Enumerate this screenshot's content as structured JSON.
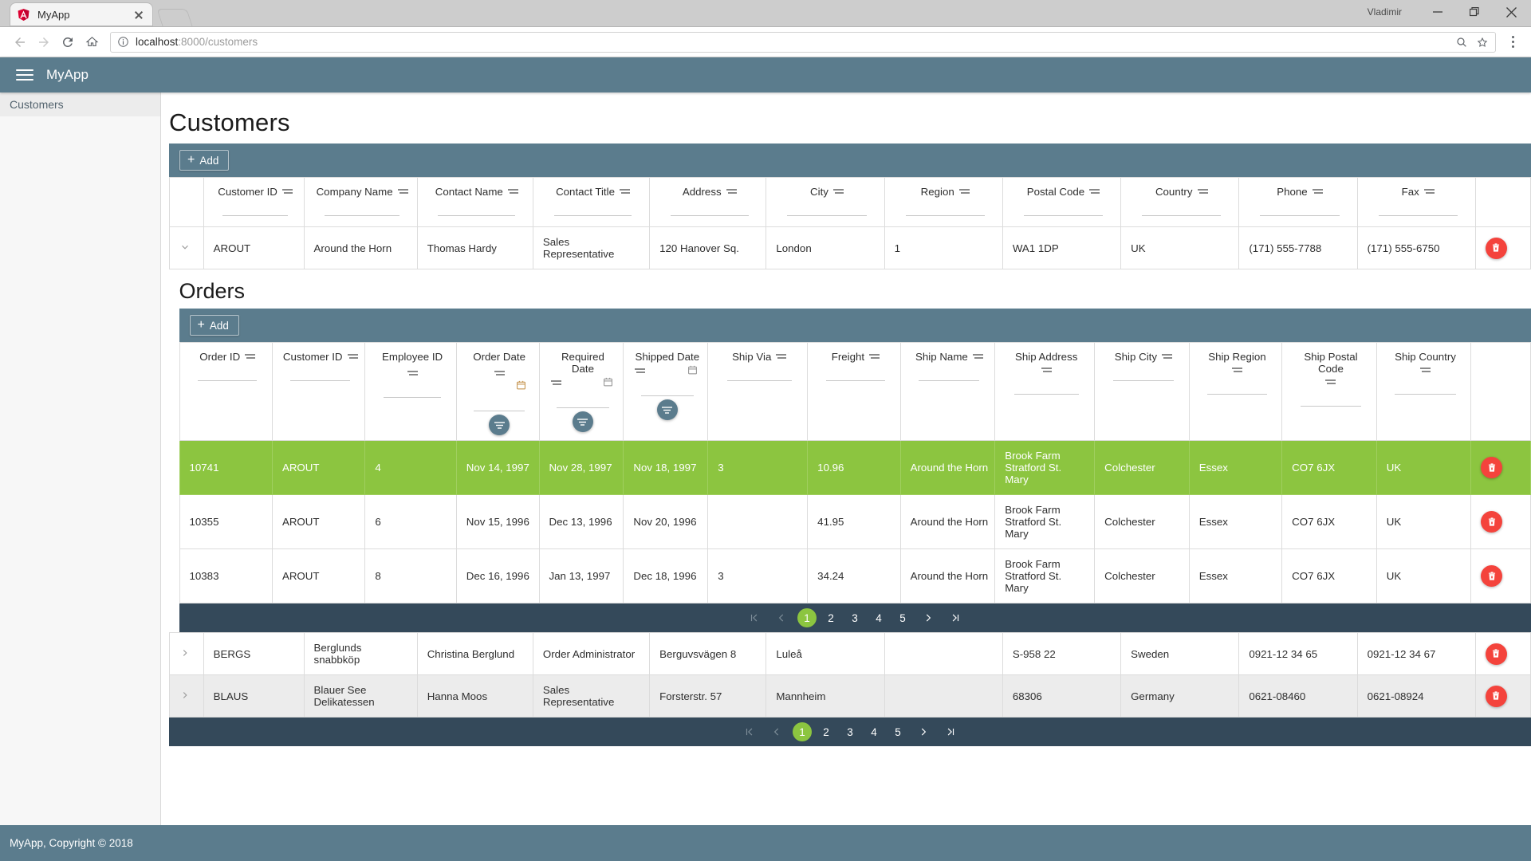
{
  "browser": {
    "tab_title": "MyApp",
    "favicon": "angular-logo-icon",
    "profile_name": "Vladimir",
    "url_host": "localhost",
    "url_rest": ":8000/customers",
    "back_icon": "back-arrow-icon",
    "forward_icon": "forward-arrow-icon",
    "reload_icon": "reload-icon",
    "home_icon": "home-icon",
    "info_icon": "page-info-icon",
    "search_icon": "search-icon",
    "star_icon": "bookmark-star-icon",
    "menu_icon": "browser-menu-icon",
    "minimize_icon": "minimize-icon",
    "maximize_icon": "restore-icon",
    "close_icon": "window-close-icon"
  },
  "app": {
    "title": "MyApp",
    "menu_icon": "hamburger-menu-icon",
    "footer": "MyApp, Copyright © 2018"
  },
  "sidebar": {
    "items": [
      {
        "label": "Customers"
      }
    ]
  },
  "customers": {
    "page_title": "Customers",
    "add_label": "Add",
    "columns": [
      "Customer ID",
      "Company Name",
      "Contact Name",
      "Contact Title",
      "Address",
      "City",
      "Region",
      "Postal Code",
      "Country",
      "Phone",
      "Fax"
    ],
    "filter_placeholder": "",
    "rows": [
      {
        "expanded": true,
        "customer_id": "AROUT",
        "company_name": "Around the Horn",
        "contact_name": "Thomas Hardy",
        "contact_title": "Sales Representative",
        "address": "120 Hanover Sq.",
        "city": "London",
        "region": "1",
        "postal_code": "WA1 1DP",
        "country": "UK",
        "phone": "(171) 555-7788",
        "fax": "(171) 555-6750"
      },
      {
        "expanded": false,
        "customer_id": "BERGS",
        "company_name": "Berglunds snabbköp",
        "contact_name": "Christina Berglund",
        "contact_title": "Order Administrator",
        "address": "Berguvsvägen 8",
        "city": "Luleå",
        "region": "",
        "postal_code": "S-958 22",
        "country": "Sweden",
        "phone": "0921-12 34 65",
        "fax": "0921-12 34 67"
      },
      {
        "expanded": false,
        "customer_id": "BLAUS",
        "company_name": "Blauer See Delikatessen",
        "contact_name": "Hanna Moos",
        "contact_title": "Sales Representative",
        "address": "Forsterstr. 57",
        "city": "Mannheim",
        "region": "",
        "postal_code": "68306",
        "country": "Germany",
        "phone": "0621-08460",
        "fax": "0621-08924"
      }
    ],
    "pager": {
      "first": "first-page-icon",
      "prev": "previous-page-icon",
      "pages": [
        "1",
        "2",
        "3",
        "4",
        "5"
      ],
      "active_page": "1",
      "next": "next-page-icon",
      "last": "last-page-icon"
    }
  },
  "orders": {
    "section_title": "Orders",
    "add_label": "Add",
    "columns": [
      {
        "label": "Order ID",
        "has_date": false
      },
      {
        "label": "Customer ID",
        "has_date": false
      },
      {
        "label": "Employee ID",
        "has_date": false
      },
      {
        "label": "Order Date",
        "has_date": true
      },
      {
        "label": "Required Date",
        "has_date": true
      },
      {
        "label": "Shipped Date",
        "has_date": true
      },
      {
        "label": "Ship Via",
        "has_date": false
      },
      {
        "label": "Freight",
        "has_date": false
      },
      {
        "label": "Ship Name",
        "has_date": false
      },
      {
        "label": "Ship Address",
        "has_date": false
      },
      {
        "label": "Ship City",
        "has_date": false
      },
      {
        "label": "Ship Region",
        "has_date": false
      },
      {
        "label": "Ship Postal Code",
        "has_date": false
      },
      {
        "label": "Ship Country",
        "has_date": false
      }
    ],
    "rows": [
      {
        "selected": true,
        "order_id": "10741",
        "customer_id": "AROUT",
        "employee_id": "4",
        "order_date": "Nov 14, 1997",
        "required_date": "Nov 28, 1997",
        "shipped_date": "Nov 18, 1997",
        "ship_via": "3",
        "freight": "10.96",
        "ship_name": "Around the Horn",
        "ship_address": "Brook Farm Stratford St. Mary",
        "ship_city": "Colchester",
        "ship_region": "Essex",
        "ship_postal_code": "CO7 6JX",
        "ship_country": "UK"
      },
      {
        "selected": false,
        "order_id": "10355",
        "customer_id": "AROUT",
        "employee_id": "6",
        "order_date": "Nov 15, 1996",
        "required_date": "Dec 13, 1996",
        "shipped_date": "Nov 20, 1996",
        "ship_via": "",
        "freight": "41.95",
        "ship_name": "Around the Horn",
        "ship_address": "Brook Farm Stratford St. Mary",
        "ship_city": "Colchester",
        "ship_region": "Essex",
        "ship_postal_code": "CO7 6JX",
        "ship_country": "UK"
      },
      {
        "selected": false,
        "order_id": "10383",
        "customer_id": "AROUT",
        "employee_id": "8",
        "order_date": "Dec 16, 1996",
        "required_date": "Jan 13, 1997",
        "shipped_date": "Dec 18, 1996",
        "ship_via": "3",
        "freight": "34.24",
        "ship_name": "Around the Horn",
        "ship_address": "Brook Farm Stratford St. Mary",
        "ship_city": "Colchester",
        "ship_region": "Essex",
        "ship_postal_code": "CO7 6JX",
        "ship_country": "UK"
      }
    ],
    "pager": {
      "pages": [
        "1",
        "2",
        "3",
        "4",
        "5"
      ],
      "active_page": "1"
    }
  },
  "colors": {
    "header_slate": "#5b7c8d",
    "pager_navy": "#34495a",
    "selected_green": "#8cc540",
    "delete_red": "#f4433c"
  }
}
